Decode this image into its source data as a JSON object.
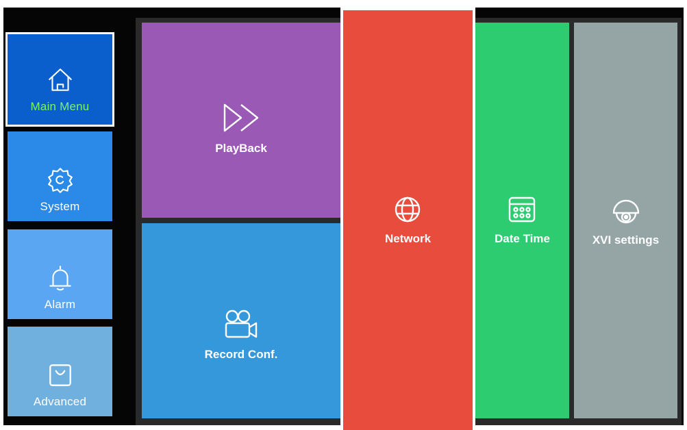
{
  "sidebar": {
    "items": [
      {
        "label": "Main Menu",
        "icon": "home-icon",
        "selected": true
      },
      {
        "label": "System",
        "icon": "gear-icon"
      },
      {
        "label": "Alarm",
        "icon": "bell-icon"
      },
      {
        "label": "Advanced",
        "icon": "bag-icon"
      }
    ]
  },
  "tiles": {
    "playback": {
      "label": "PlayBack",
      "icon": "fast-forward-icon"
    },
    "record": {
      "label": "Record Conf.",
      "icon": "video-camera-icon"
    },
    "network": {
      "label": "Network",
      "icon": "globe-icon"
    },
    "datetime": {
      "label": "Date Time",
      "icon": "calendar-icon"
    },
    "xvi": {
      "label": "XVI settings",
      "icon": "dome-camera-icon"
    }
  },
  "colors": {
    "main_menu": "#0a5fcc",
    "main_menu_label": "#7cf26a",
    "system": "#2b8ae8",
    "alarm": "#5aa6f2",
    "advanced": "#6fb0de",
    "playback": "#9b59b6",
    "record": "#3498db",
    "network": "#e74c3c",
    "datetime": "#2ecc71",
    "xvi": "#95a5a6"
  }
}
